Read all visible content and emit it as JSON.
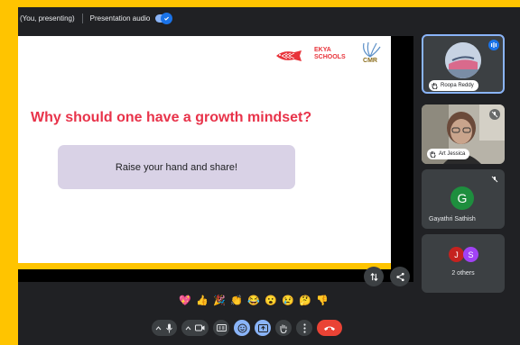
{
  "top_bar": {
    "presenting_label": "(You, presenting)",
    "audio_label": "Presentation audio",
    "audio_enabled": true
  },
  "slide": {
    "logo_text_line1": "EKYA",
    "logo_text_line2": "SCHOOLS",
    "logo_cmr": "CMR",
    "title": "Why should one have a growth mindset?",
    "prompt": "Raise your hand and share!"
  },
  "participants": [
    {
      "name": "Roopa Reddy",
      "hand_raised": true,
      "speaking": true
    },
    {
      "name": "Art Jessica",
      "hand_raised": true,
      "muted": true
    },
    {
      "name": "Gayathri Sathish",
      "initial": "G",
      "avatar_color": "#1e8e3e",
      "muted": true
    }
  ],
  "others": {
    "label": "2 others",
    "initials": [
      "J",
      "S"
    ],
    "colors": [
      "#c5221f",
      "#a142f4"
    ]
  },
  "reactions": [
    "💖",
    "👍",
    "🎉",
    "👏",
    "😂",
    "😮",
    "😢",
    "🤔",
    "👎"
  ],
  "colors": {
    "accent": "#8ab4f8",
    "background": "#202124",
    "end_call": "#ea4335",
    "slide_title": "#e8334a",
    "frame": "#FFC400"
  }
}
